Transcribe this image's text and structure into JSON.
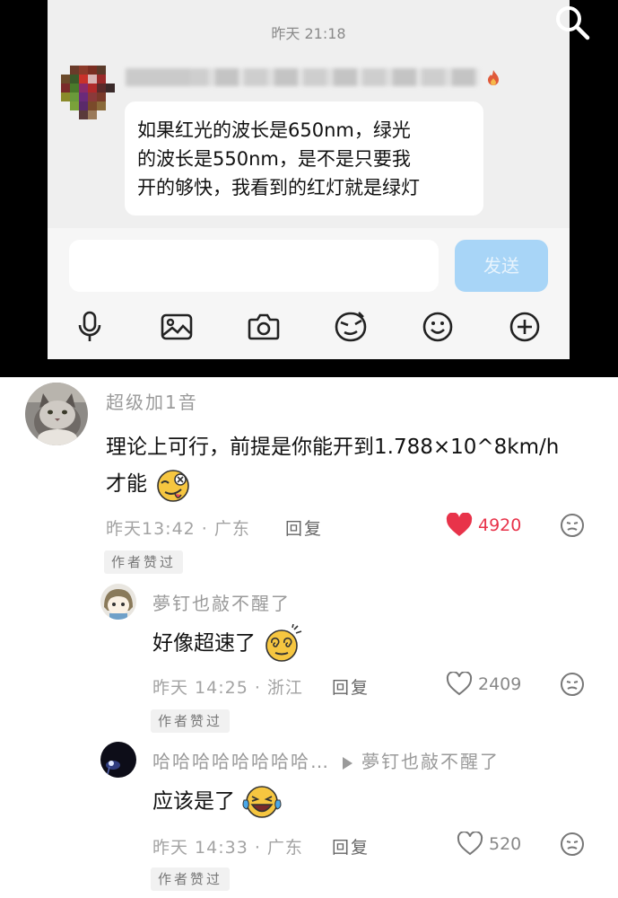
{
  "chat": {
    "timestamp": "昨天 21:18",
    "message_lines": [
      "如果红光的波长是650nm，绿光",
      "的波长是550nm，是不是只要我",
      "开的够快，我看到的红灯就是绿灯"
    ],
    "input_value": "",
    "send_label": "发送",
    "tools": [
      "microphone-icon",
      "image-icon",
      "camera-icon",
      "sticker-icon",
      "emoji-icon",
      "plus-icon"
    ]
  },
  "comments": [
    {
      "username": "超级加1音",
      "text_line1": "理论上可行，前提是你能开到1.788×10^8km/h",
      "text_line2": "才能",
      "emoji": "smirk-tongue-emoji",
      "time_location": "昨天13:42 · 广东",
      "reply_label": "回复",
      "likes": "4920",
      "liked": true,
      "badge": "作者赞过"
    },
    {
      "username": "夢钉也敲不醒了",
      "text": "好像超速了",
      "emoji": "dizzy-emoji",
      "time_location": "昨天 14:25 · 浙江",
      "reply_label": "回复",
      "likes": "2409",
      "liked": false,
      "badge": "作者赞过"
    },
    {
      "username": "哈哈哈哈哈哈哈哈…",
      "reply_to": "夢钉也敲不醒了",
      "text": "应该是了",
      "emoji": "laughing-tears-emoji",
      "time_location": "昨天 14:33 · 广东",
      "reply_label": "回复",
      "likes": "520",
      "liked": false,
      "badge": "作者赞过"
    }
  ],
  "colors": {
    "like_red": "#e8334a",
    "send_button": "#a8d5f7",
    "meta_gray": "#a3a3a3"
  }
}
